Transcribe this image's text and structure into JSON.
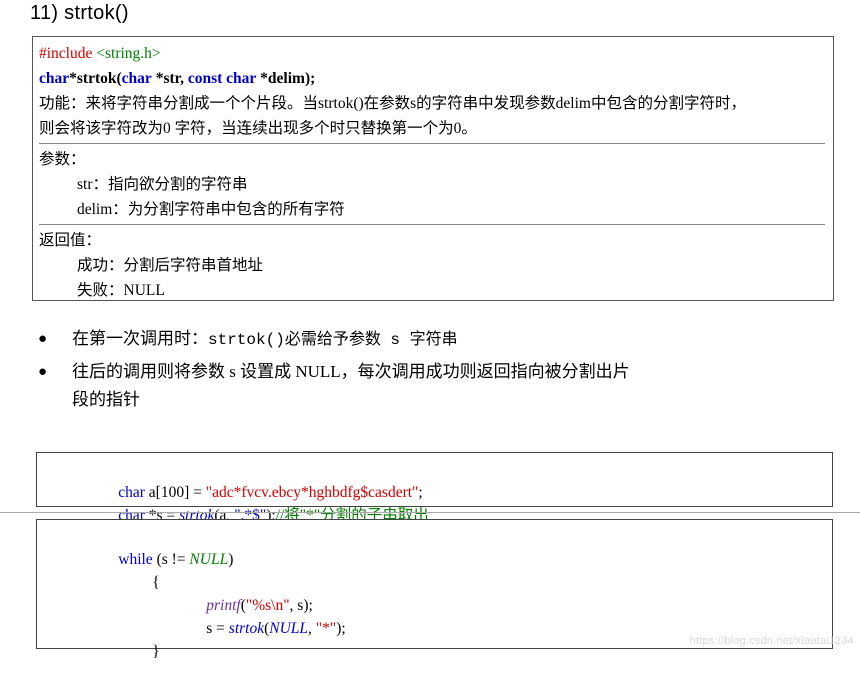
{
  "title": "11) strtok()",
  "spec": {
    "include": {
      "directive": "#include",
      "header": "<string.h>"
    },
    "prototype": {
      "ret_type": "char",
      "star_name": "*strtok",
      "open": "(",
      "arg1": "char",
      "arg1_name": "*str,",
      "arg2": "const char",
      "arg2_name": "*delim",
      "close": ");"
    },
    "function_label": "功能：",
    "function_desc_1": "来将字符串分割成一个个片段。当strtok()在参数s的字符串中发现参数delim中包含的分割字符时，",
    "function_desc_2": "则会将该字符改为0 字符，当连续出现多个时只替换第一个为0。",
    "params_label": "参数：",
    "param_str": "str：指向欲分割的字符串",
    "param_delim": "delim：为分割字符串中包含的所有字符",
    "return_label": "返回值：",
    "return_success": "成功：分割后字符串首地址",
    "return_fail": "失败：NULL"
  },
  "bullets": [
    {
      "marker": "●",
      "text_before": "在第一次调用时：",
      "code": "strtok()",
      "text_after": "必需给予参数 s 字符串"
    },
    {
      "marker": "●",
      "text_before": "往后的调用则将参数 s 设置成 NULL，每次调用成功则返回指向被分割出片",
      "code": "",
      "text_after": "段的指针"
    }
  ],
  "code_box_1": {
    "line1": {
      "kw": "char",
      "rest_a": " a[100] = ",
      "str": "\"adc*fvcv.ebcy*hghbdfg$casdert\"",
      "rest_b": ";"
    },
    "line2": {
      "kw": "char",
      "rest_a": " *s = ",
      "fn": "strtok",
      "rest_b": "(a, ",
      "str": "\".*$\"",
      "rest_c": ");",
      "comment": "//将\"*\"分割的子串取出"
    }
  },
  "code_box_2": {
    "line1": {
      "kw": "while",
      "rest_a": " (s != ",
      "null": "NULL",
      "rest_b": ")"
    },
    "line2": "{",
    "line3": {
      "fn": "printf",
      "rest_a": "(",
      "str": "\"%s\\n\"",
      "rest_b": ", s);"
    },
    "line4": {
      "rest_a": "s = ",
      "fn": "strtok",
      "rest_b": "(",
      "null": "NULL",
      "rest_c": ", ",
      "str": "\"*\"",
      "rest_d": ");"
    },
    "line5": "}"
  },
  "watermark": "https://blog.csdn.net/xiaotai1234",
  "colors": {
    "red": "#d00000",
    "blue": "#0000cc",
    "green": "#008000",
    "purple": "#7030a0"
  }
}
